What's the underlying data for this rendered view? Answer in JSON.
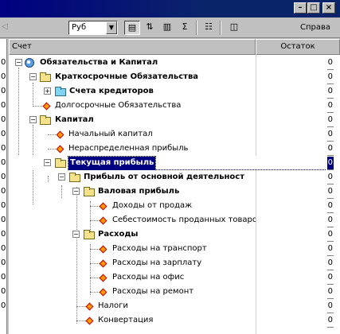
{
  "toolbar": {
    "currency": "Руб",
    "help_label": "Справа"
  },
  "grid": {
    "col_account": "Счет",
    "col_balance": "Остаток"
  },
  "rows": [
    {
      "label": "Обязательства и Капитал",
      "value": "0",
      "bold": true
    },
    {
      "label": "Краткосрочные Обязательства",
      "value": "0",
      "bold": true
    },
    {
      "label": "Счета кредиторов",
      "value": "0",
      "bold": true
    },
    {
      "label": "Долгосрочные Обязательства",
      "value": "0",
      "bold": false
    },
    {
      "label": "Капитал",
      "value": "0",
      "bold": true
    },
    {
      "label": "Начальный капитал",
      "value": "0",
      "bold": false
    },
    {
      "label": "Нераспределенная прибыль",
      "value": "0",
      "bold": false
    },
    {
      "label": "Текущая прибыль",
      "value": "0",
      "bold": true,
      "selected": true
    },
    {
      "label": "Прибыль от основной деятельност",
      "value": "0",
      "bold": true
    },
    {
      "label": "Валовая прибыль",
      "value": "0",
      "bold": true
    },
    {
      "label": "Доходы от продаж",
      "value": "0",
      "bold": false
    },
    {
      "label": "Себестоимость проданных товаро",
      "value": "0",
      "bold": false
    },
    {
      "label": "Расходы",
      "value": "0",
      "bold": true
    },
    {
      "label": "Расходы на транспорт",
      "value": "0",
      "bold": false
    },
    {
      "label": "Расходы на зарплату",
      "value": "0",
      "bold": false
    },
    {
      "label": "Расходы на офис",
      "value": "0",
      "bold": false
    },
    {
      "label": "Расходы на ремонт",
      "value": "0",
      "bold": false
    },
    {
      "label": "Налоги",
      "value": "0",
      "bold": false
    },
    {
      "label": "Конвертация",
      "value": "0",
      "bold": false
    }
  ],
  "left_stub_values": [
    "0",
    "0",
    "0",
    "0",
    "0",
    "0",
    "0",
    "0",
    "0",
    "0",
    "0",
    "0",
    "0",
    "0",
    "0",
    "0",
    "0",
    "0"
  ]
}
